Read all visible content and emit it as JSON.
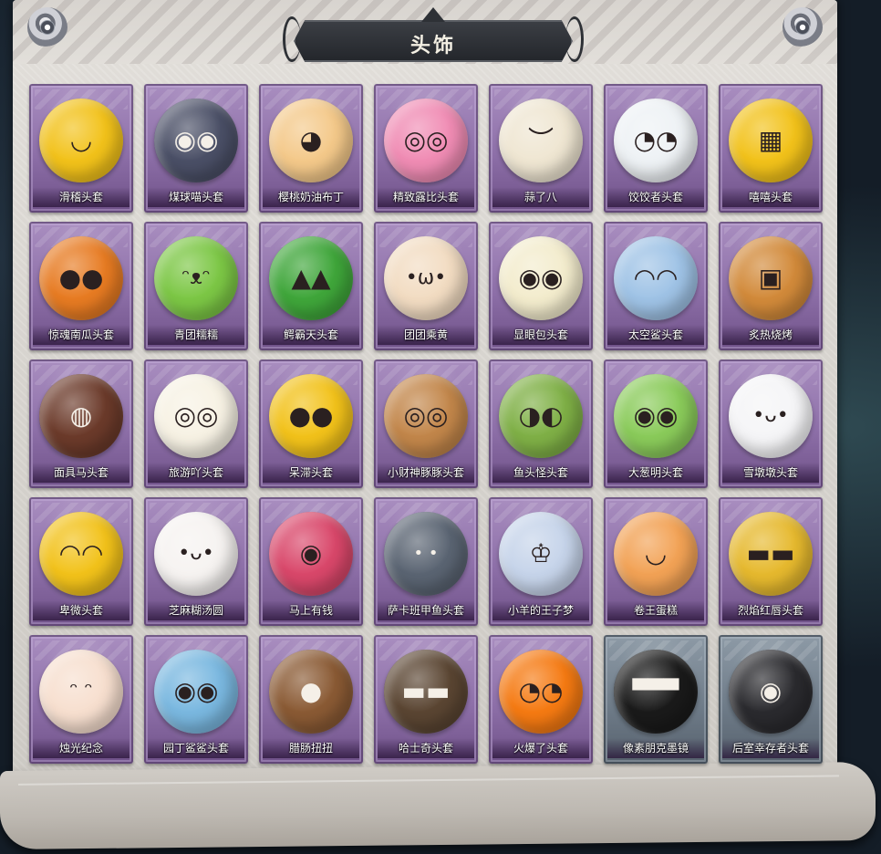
{
  "header": {
    "title": "头饰"
  },
  "items": [
    {
      "label": "滑稽头套",
      "icon": "smirk-face-icon",
      "color": "#f2c21a",
      "glyph": "◡"
    },
    {
      "label": "煤球喵头套",
      "icon": "black-cat-icon",
      "color": "#4a4f66",
      "glyph": "◉◉"
    },
    {
      "label": "樱桃奶油布丁",
      "icon": "pudding-icon",
      "color": "#f4c98a",
      "glyph": "◕"
    },
    {
      "label": "精致露比头套",
      "icon": "pink-beaver-icon",
      "color": "#f08cb4",
      "glyph": "◎◎"
    },
    {
      "label": "蒜了八",
      "icon": "garlic-icon",
      "color": "#efe6d2",
      "glyph": "︶"
    },
    {
      "label": "饺饺者头套",
      "icon": "dumpling-cloud-icon",
      "color": "#eef2f5",
      "glyph": "◔◔"
    },
    {
      "label": "嘻嘻头套",
      "icon": "grin-face-icon",
      "color": "#f2c21a",
      "glyph": "▦"
    },
    {
      "label": "惊魂南瓜头套",
      "icon": "pumpkin-icon",
      "color": "#e77b22",
      "glyph": "●●"
    },
    {
      "label": "青团糯糯",
      "icon": "green-rice-ball-icon",
      "color": "#7cc745",
      "glyph": "ᵔᴥᵔ"
    },
    {
      "label": "鳄霸天头套",
      "icon": "crocodile-icon",
      "color": "#3fa63a",
      "glyph": "▲▲"
    },
    {
      "label": "团团乘黄",
      "icon": "hamster-icon",
      "color": "#f2dcc2",
      "glyph": "•ω•"
    },
    {
      "label": "显眼包头套",
      "icon": "light-bulb-icon",
      "color": "#f3eccd",
      "glyph": "◉◉"
    },
    {
      "label": "太空鲨头套",
      "icon": "shark-icon",
      "color": "#9fc3e6",
      "glyph": "◠◠"
    },
    {
      "label": "炙热烧烤",
      "icon": "grilled-meat-icon",
      "color": "#d28a3a",
      "glyph": "▣"
    },
    {
      "label": "面具马头套",
      "icon": "horse-mask-icon",
      "color": "#6b3a2a",
      "glyph": "◍"
    },
    {
      "label": "旅游吖头套",
      "icon": "duck-hat-icon",
      "color": "#f7f2e4",
      "glyph": "◎◎"
    },
    {
      "label": "呆滞头套",
      "icon": "stare-face-icon",
      "color": "#f2c21a",
      "glyph": "●●"
    },
    {
      "label": "小财神豚豚头套",
      "icon": "capybara-icon",
      "color": "#c2864a",
      "glyph": "◎◎"
    },
    {
      "label": "鱼头怪头套",
      "icon": "fish-head-icon",
      "color": "#7fb046",
      "glyph": "◑◐"
    },
    {
      "label": "大葱明头套",
      "icon": "green-onion-icon",
      "color": "#8acb5a",
      "glyph": "◉◉"
    },
    {
      "label": "雪墩墩头套",
      "icon": "snowman-icon",
      "color": "#f5f5f7",
      "glyph": "•ᴗ•"
    },
    {
      "label": "卑微头套",
      "icon": "meek-face-icon",
      "color": "#f2c21a",
      "glyph": "◠◠"
    },
    {
      "label": "芝麻糊汤圆",
      "icon": "rice-dumpling-icon",
      "color": "#f6f3f1",
      "glyph": "•ᴗ•"
    },
    {
      "label": "马上有钱",
      "icon": "red-horse-icon",
      "color": "#d9476a",
      "glyph": "◉"
    },
    {
      "label": "萨卡班甲鱼头套",
      "icon": "sacabambaspis-icon",
      "color": "#5a6472",
      "glyph": "•  •"
    },
    {
      "label": "小羊的王子梦",
      "icon": "sheep-crown-icon",
      "color": "#c6d4ea",
      "glyph": "♔"
    },
    {
      "label": "卷王蛋糕",
      "icon": "roll-cake-icon",
      "color": "#f2a255",
      "glyph": "◡"
    },
    {
      "label": "烈焰红唇头套",
      "icon": "pikachu-mask-icon",
      "color": "#e6b92e",
      "glyph": "▬▬"
    },
    {
      "label": "烛光纪念",
      "icon": "candle-icon",
      "color": "#f7dfcf",
      "glyph": "ᵔ ᵔ"
    },
    {
      "label": "园丁鲨鲨头套",
      "icon": "gardener-shark-icon",
      "color": "#7ab8e0",
      "glyph": "◉◉"
    },
    {
      "label": "腊肠扭扭",
      "icon": "dachshund-icon",
      "color": "#8a5a34",
      "glyph": "●"
    },
    {
      "label": "哈士奇头套",
      "icon": "husky-icon",
      "color": "#5a4532",
      "glyph": "▬▬"
    },
    {
      "label": "火爆了头套",
      "icon": "fireball-icon",
      "color": "#f57a12",
      "glyph": "◔◔"
    },
    {
      "label": "像素朋克墨镜",
      "icon": "pixel-sunglasses-icon",
      "color": "#1a1a1a",
      "glyph": "▀▀▀",
      "rarity": "grey"
    },
    {
      "label": "后室幸存者头套",
      "icon": "gas-mask-helmet-icon",
      "color": "#2a2a2e",
      "glyph": "◉",
      "rarity": "grey"
    }
  ]
}
